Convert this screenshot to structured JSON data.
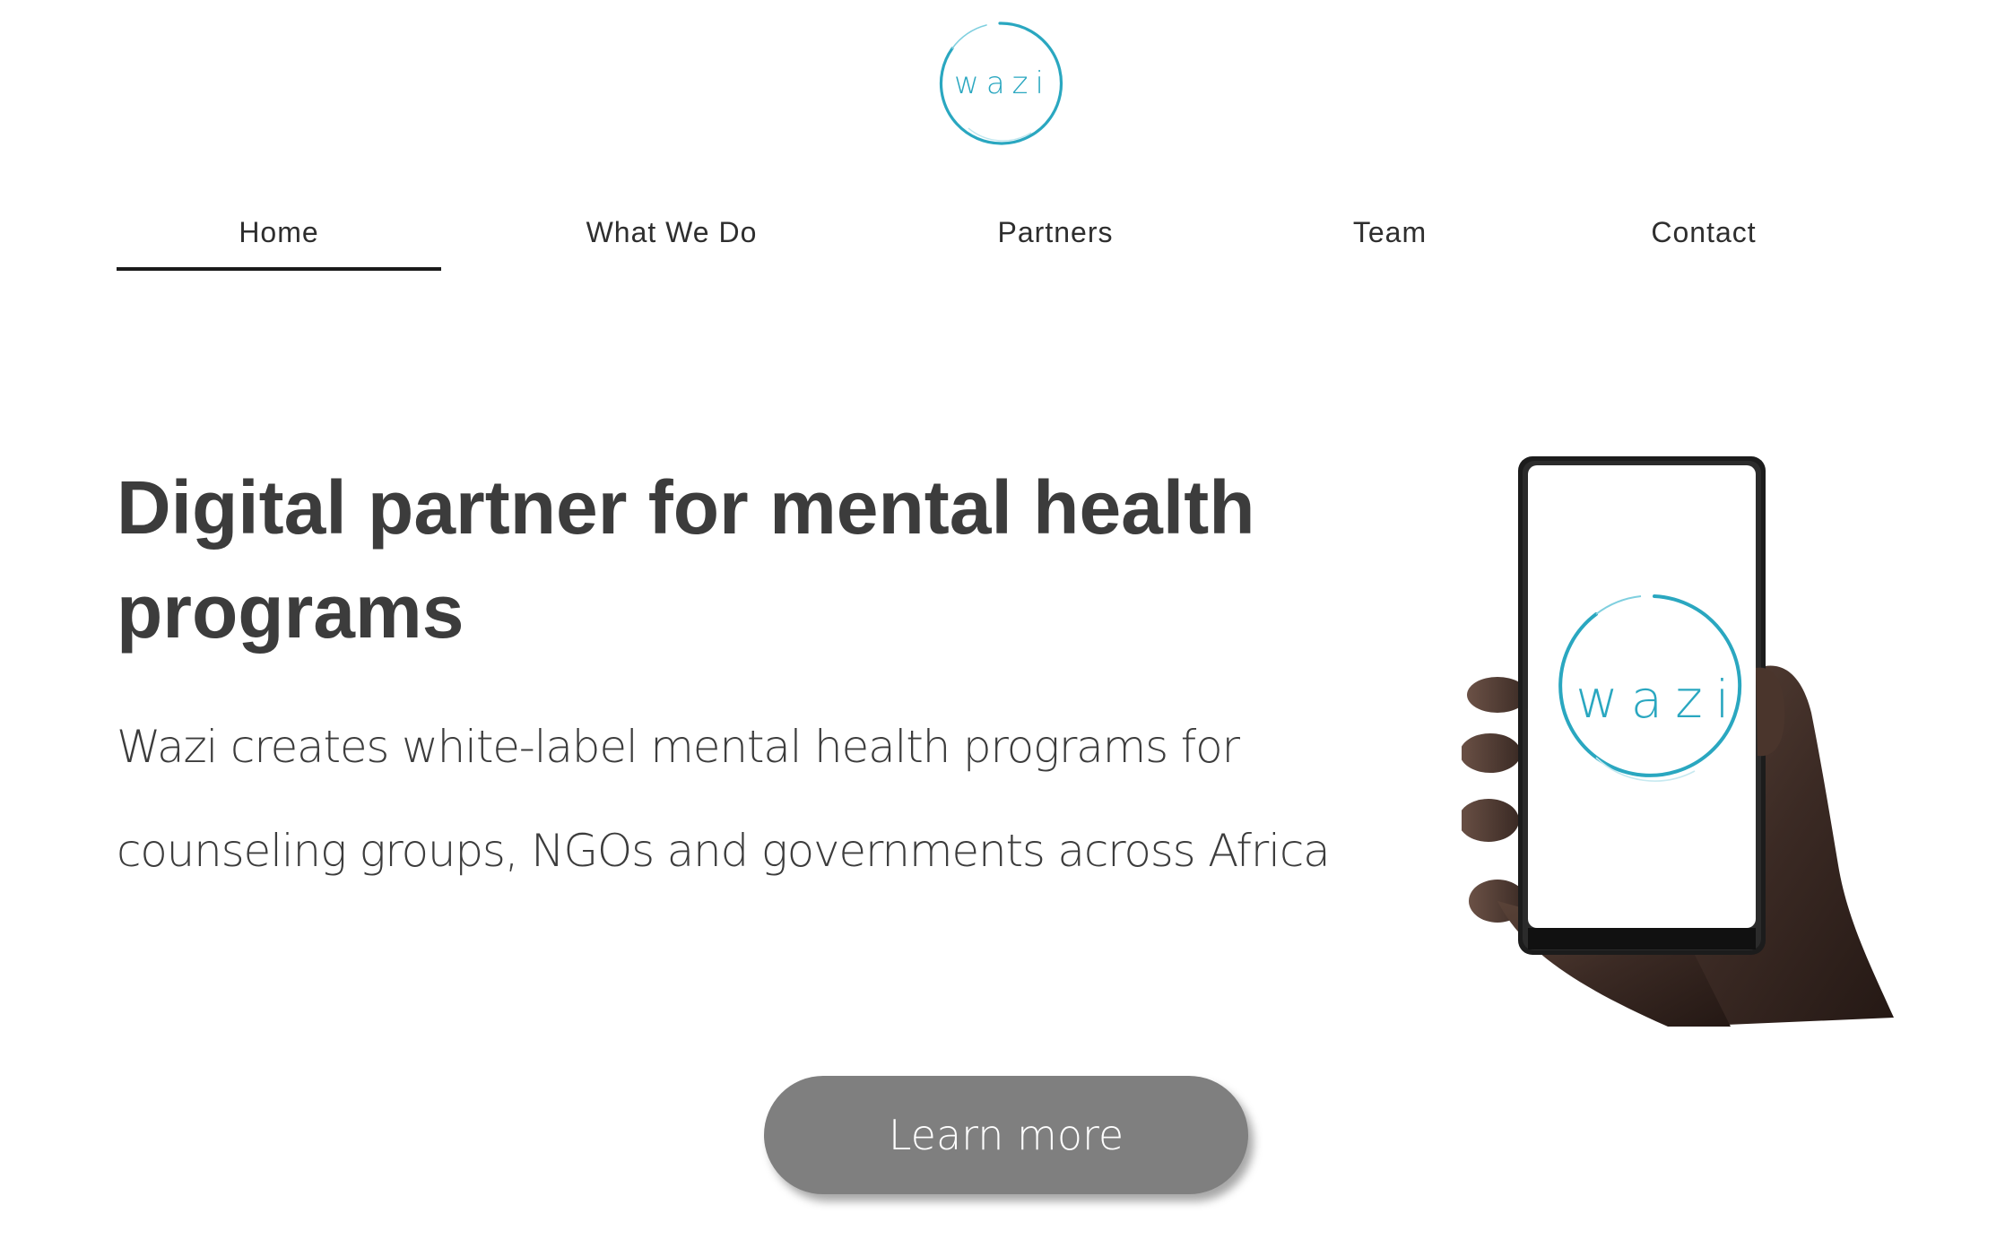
{
  "logo": {
    "text": "wazi",
    "accent_color": "#2aa7c0"
  },
  "nav": {
    "items": [
      {
        "label": "Home",
        "active": true
      },
      {
        "label": "What We Do",
        "active": false
      },
      {
        "label": "Partners",
        "active": false
      },
      {
        "label": "Team",
        "active": false
      },
      {
        "label": "Contact",
        "active": false
      }
    ]
  },
  "hero": {
    "title": "Digital partner for mental health programs",
    "subtitle": "Wazi creates white-label mental health programs for counseling groups, NGOs and governments across Africa",
    "phone_screen_logo": "wazi",
    "cta_label": "Learn more"
  },
  "colors": {
    "text": "#3c3c3c",
    "button": "#7f7f7f",
    "button_text": "#ffffff",
    "active_underline": "#1a1a1a"
  },
  "icons": {
    "logo": "wazi-circle-logo",
    "phone": "hand-holding-phone-illustration"
  }
}
